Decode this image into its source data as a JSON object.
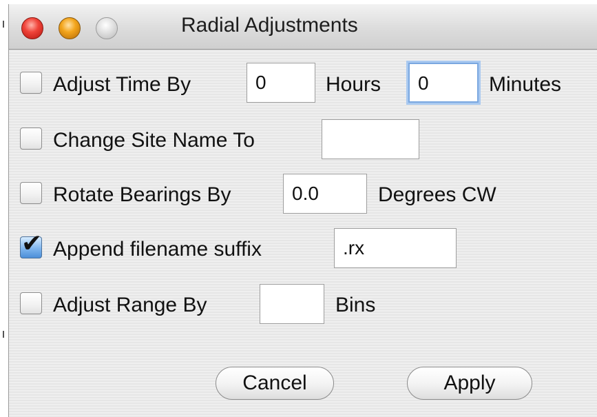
{
  "window": {
    "title": "Radial Adjustments"
  },
  "rows": [
    {
      "checked": false,
      "label": "Adjust Time By",
      "field1_value": "0",
      "unit1": "Hours",
      "field2_value": "0",
      "unit2": "Minutes"
    },
    {
      "checked": false,
      "label": "Change Site Name To",
      "field_value": ""
    },
    {
      "checked": false,
      "label": "Rotate Bearings By",
      "field_value": "0.0",
      "unit": "Degrees CW"
    },
    {
      "checked": true,
      "label": "Append filename suffix",
      "field_value": ".rx"
    },
    {
      "checked": false,
      "label": "Adjust Range By",
      "field_value": "",
      "unit": "Bins"
    }
  ],
  "buttons": {
    "cancel_label": "Cancel",
    "apply_label": "Apply"
  },
  "colors": {
    "close": "#f0443a",
    "minimize": "#f3a51c",
    "zoom": "#dcdcdc",
    "checked_fill": "#4c8fd8",
    "focus_ring": "#7aa7e0"
  }
}
